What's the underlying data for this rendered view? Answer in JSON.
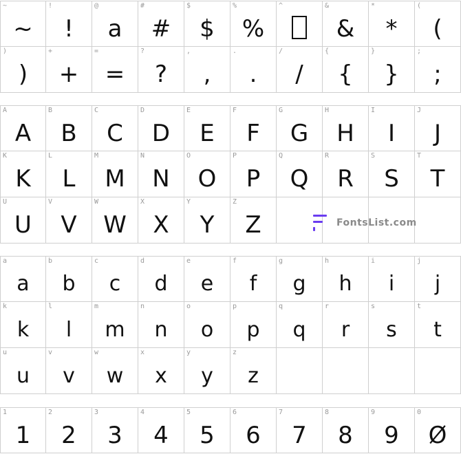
{
  "sections": [
    {
      "rows": [
        [
          {
            "label": "~",
            "glyph": "~"
          },
          {
            "label": "!",
            "glyph": "!"
          },
          {
            "label": "@",
            "glyph": "a"
          },
          {
            "label": "#",
            "glyph": "#"
          },
          {
            "label": "$",
            "glyph": "$"
          },
          {
            "label": "%",
            "glyph": "%"
          },
          {
            "label": "^",
            "glyph": ""
          },
          {
            "label": "&",
            "glyph": "&"
          },
          {
            "label": "*",
            "glyph": "*"
          },
          {
            "label": "(",
            "glyph": "("
          }
        ],
        [
          {
            "label": ")",
            "glyph": ")"
          },
          {
            "label": "+",
            "glyph": "+"
          },
          {
            "label": "=",
            "glyph": "="
          },
          {
            "label": "?",
            "glyph": "?"
          },
          {
            "label": ",",
            "glyph": ","
          },
          {
            "label": ".",
            "glyph": "."
          },
          {
            "label": "/",
            "glyph": "/"
          },
          {
            "label": "{",
            "glyph": "{"
          },
          {
            "label": "}",
            "glyph": "}"
          },
          {
            "label": ";",
            "glyph": ";"
          }
        ]
      ]
    },
    {
      "rows": [
        [
          {
            "label": "A",
            "glyph": "A"
          },
          {
            "label": "B",
            "glyph": "B"
          },
          {
            "label": "C",
            "glyph": "C"
          },
          {
            "label": "D",
            "glyph": "D"
          },
          {
            "label": "E",
            "glyph": "E"
          },
          {
            "label": "F",
            "glyph": "F"
          },
          {
            "label": "G",
            "glyph": "G"
          },
          {
            "label": "H",
            "glyph": "H"
          },
          {
            "label": "I",
            "glyph": "I"
          },
          {
            "label": "J",
            "glyph": "J"
          }
        ],
        [
          {
            "label": "K",
            "glyph": "K"
          },
          {
            "label": "L",
            "glyph": "L"
          },
          {
            "label": "M",
            "glyph": "M"
          },
          {
            "label": "N",
            "glyph": "N"
          },
          {
            "label": "O",
            "glyph": "O"
          },
          {
            "label": "P",
            "glyph": "P"
          },
          {
            "label": "Q",
            "glyph": "Q"
          },
          {
            "label": "R",
            "glyph": "R"
          },
          {
            "label": "S",
            "glyph": "S"
          },
          {
            "label": "T",
            "glyph": "T"
          }
        ],
        [
          {
            "label": "U",
            "glyph": "U"
          },
          {
            "label": "V",
            "glyph": "V"
          },
          {
            "label": "W",
            "glyph": "W"
          },
          {
            "label": "X",
            "glyph": "X"
          },
          {
            "label": "Y",
            "glyph": "Y"
          },
          {
            "label": "Z",
            "glyph": "Z"
          },
          {
            "label": "",
            "glyph": ""
          },
          {
            "label": "",
            "glyph": ""
          },
          {
            "label": "",
            "glyph": ""
          },
          {
            "label": "",
            "glyph": ""
          }
        ]
      ]
    },
    {
      "rows": [
        [
          {
            "label": "a",
            "glyph": "a"
          },
          {
            "label": "b",
            "glyph": "b"
          },
          {
            "label": "c",
            "glyph": "c"
          },
          {
            "label": "d",
            "glyph": "d"
          },
          {
            "label": "e",
            "glyph": "e"
          },
          {
            "label": "f",
            "glyph": "f"
          },
          {
            "label": "g",
            "glyph": "g"
          },
          {
            "label": "h",
            "glyph": "h"
          },
          {
            "label": "i",
            "glyph": "i"
          },
          {
            "label": "j",
            "glyph": "j"
          }
        ],
        [
          {
            "label": "k",
            "glyph": "k"
          },
          {
            "label": "l",
            "glyph": "l"
          },
          {
            "label": "m",
            "glyph": "m"
          },
          {
            "label": "n",
            "glyph": "n"
          },
          {
            "label": "o",
            "glyph": "o"
          },
          {
            "label": "p",
            "glyph": "p"
          },
          {
            "label": "q",
            "glyph": "q"
          },
          {
            "label": "r",
            "glyph": "r"
          },
          {
            "label": "s",
            "glyph": "s"
          },
          {
            "label": "t",
            "glyph": "t"
          }
        ],
        [
          {
            "label": "u",
            "glyph": "u"
          },
          {
            "label": "v",
            "glyph": "v"
          },
          {
            "label": "w",
            "glyph": "w"
          },
          {
            "label": "x",
            "glyph": "x"
          },
          {
            "label": "y",
            "glyph": "y"
          },
          {
            "label": "z",
            "glyph": "z"
          },
          {
            "label": "",
            "glyph": ""
          },
          {
            "label": "",
            "glyph": ""
          },
          {
            "label": "",
            "glyph": ""
          },
          {
            "label": "",
            "glyph": ""
          }
        ]
      ]
    },
    {
      "rows": [
        [
          {
            "label": "1",
            "glyph": "1"
          },
          {
            "label": "2",
            "glyph": "2"
          },
          {
            "label": "3",
            "glyph": "3"
          },
          {
            "label": "4",
            "glyph": "4"
          },
          {
            "label": "5",
            "glyph": "5"
          },
          {
            "label": "6",
            "glyph": "6"
          },
          {
            "label": "7",
            "glyph": "7"
          },
          {
            "label": "8",
            "glyph": "8"
          },
          {
            "label": "9",
            "glyph": "9"
          },
          {
            "label": "0",
            "glyph": "Ø"
          }
        ]
      ]
    }
  ],
  "watermark": {
    "text": "FontsList.com",
    "icon": "fontslist-logo-icon",
    "accent": "#6a3cf0"
  }
}
